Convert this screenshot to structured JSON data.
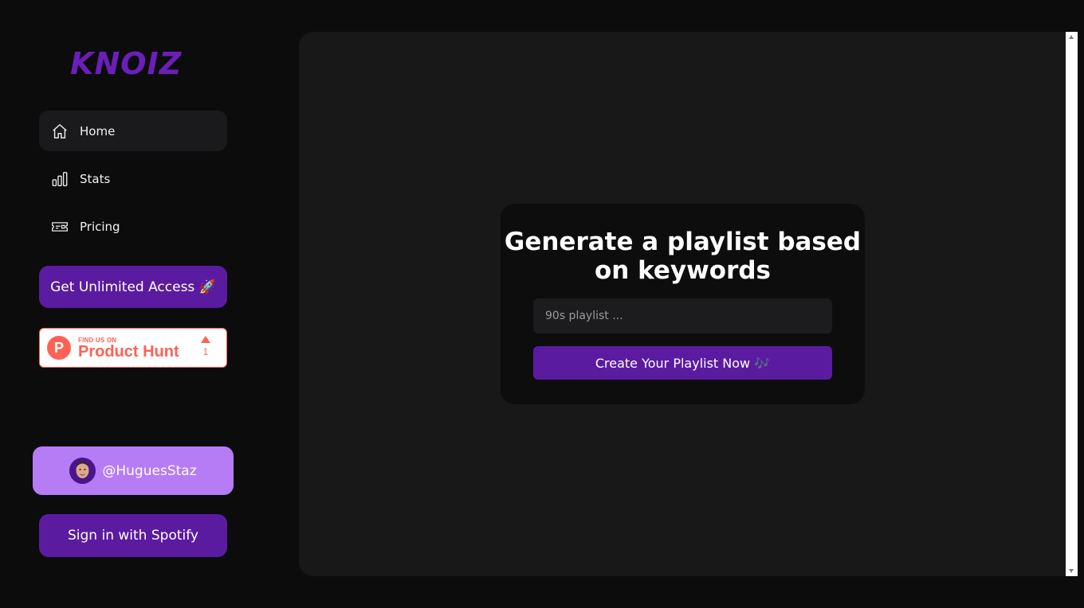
{
  "brand": {
    "logo_text": "KNOIZ",
    "accent_color": "#5b1ba0"
  },
  "sidebar": {
    "items": [
      {
        "label": "Home",
        "icon": "home-icon",
        "active": true
      },
      {
        "label": "Stats",
        "icon": "bar-chart-icon",
        "active": false
      },
      {
        "label": "Pricing",
        "icon": "ticket-icon",
        "active": false
      }
    ],
    "unlimited_label": "Get Unlimited Access 🚀",
    "product_hunt": {
      "small": "FIND US ON",
      "big": "Product Hunt",
      "count": "1"
    },
    "user": {
      "handle": "@HuguesStaz"
    },
    "signin_label": "Sign in with Spotify"
  },
  "main": {
    "title": "Generate a playlist based on keywords",
    "search": {
      "placeholder": "90s playlist ...",
      "value": ""
    },
    "create_label": "Create Your Playlist Now 🎶"
  }
}
